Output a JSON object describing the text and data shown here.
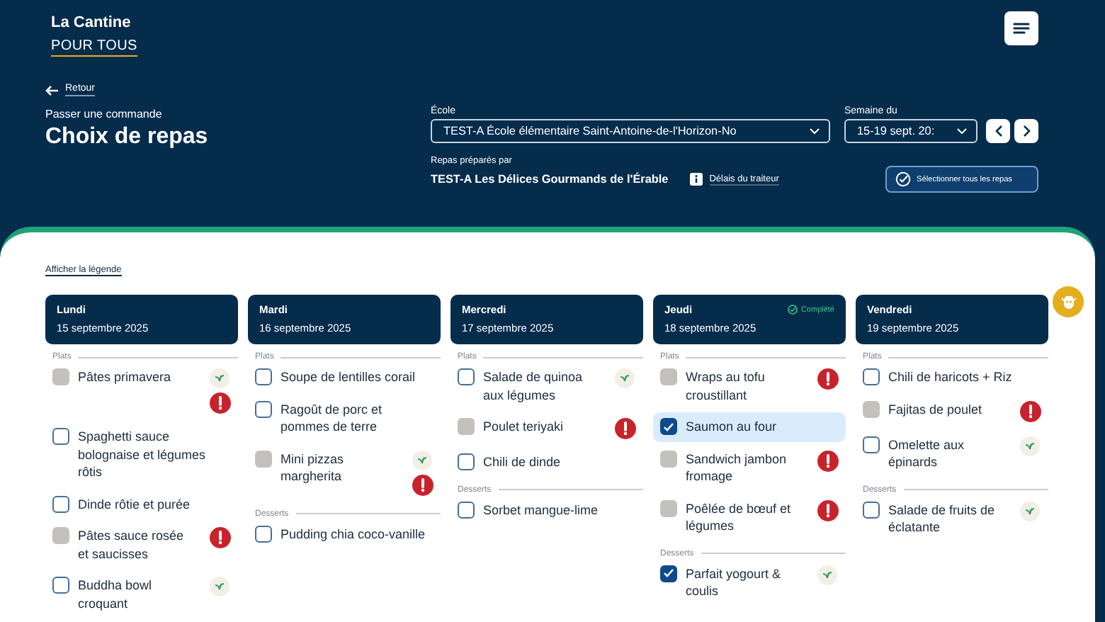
{
  "logo": {
    "line_1": "La Cantine",
    "line_2": "POUR TOUS"
  },
  "back_link": "Retour",
  "page": {
    "subtitle": "Passer une commande",
    "title": "Choix de repas"
  },
  "school": {
    "label": "École",
    "value": "TEST-A École élémentaire Saint-Antoine-de-l'Horizon-No"
  },
  "week": {
    "label": "Semaine du",
    "value": "15-19 sept. 20:"
  },
  "caterer": {
    "label": "Repas préparés par",
    "name": "TEST-A Les Délices Gourmands de l'Érable",
    "link": "Délais du traiteur"
  },
  "select_all_button": "Sélectionner tous les repas",
  "legend_link": "Afficher la légende",
  "days": [
    {
      "name": "Lundi",
      "date": "15 septembre 2025",
      "groups": [
        {
          "label": "Plats",
          "items": [
            {
              "name": "Pâtes primavera",
              "checked": false,
              "disabled": true,
              "highlighted": false,
              "vegetarian": true,
              "alert": true
            },
            {
              "name": "Spaghetti sauce bolognaise et légumes rôtis",
              "checked": false,
              "disabled": false,
              "highlighted": false,
              "vegetarian": false,
              "alert": false
            },
            {
              "name": "Dinde rôtie et purée",
              "checked": false,
              "disabled": false,
              "highlighted": false,
              "vegetarian": false,
              "alert": false
            },
            {
              "name": "Pâtes sauce rosée et saucisses",
              "checked": false,
              "disabled": true,
              "highlighted": false,
              "vegetarian": false,
              "alert": true
            },
            {
              "name": "Buddha bowl croquant",
              "checked": false,
              "disabled": false,
              "highlighted": false,
              "vegetarian": true,
              "alert": false
            }
          ]
        }
      ]
    },
    {
      "name": "Mardi",
      "date": "16 septembre 2025",
      "groups": [
        {
          "label": "Plats",
          "items": [
            {
              "name": "Soupe de lentilles corail",
              "checked": false,
              "disabled": false,
              "highlighted": false,
              "vegetarian": false,
              "alert": false
            },
            {
              "name": "Ragoût de porc et pommes de terre",
              "checked": false,
              "disabled": false,
              "highlighted": false,
              "vegetarian": false,
              "alert": false
            },
            {
              "name": "Mini pizzas margherita",
              "checked": false,
              "disabled": true,
              "highlighted": false,
              "vegetarian": true,
              "alert": true
            }
          ]
        },
        {
          "label": "Desserts",
          "items": [
            {
              "name": "Pudding chia coco-vanille",
              "checked": false,
              "disabled": false,
              "highlighted": false,
              "vegetarian": false,
              "alert": false
            }
          ]
        }
      ]
    },
    {
      "name": "Mercredi",
      "date": "17 septembre 2025",
      "groups": [
        {
          "label": "Plats",
          "items": [
            {
              "name": "Salade de quinoa aux légumes",
              "checked": false,
              "disabled": false,
              "highlighted": false,
              "vegetarian": true,
              "alert": false
            },
            {
              "name": "Poulet teriyaki",
              "checked": false,
              "disabled": true,
              "highlighted": false,
              "vegetarian": false,
              "alert": true
            },
            {
              "name": "Chili de dinde",
              "checked": false,
              "disabled": false,
              "highlighted": false,
              "vegetarian": false,
              "alert": false
            }
          ]
        },
        {
          "label": "Desserts",
          "items": [
            {
              "name": "Sorbet mangue-lime",
              "checked": false,
              "disabled": false,
              "highlighted": false,
              "vegetarian": false,
              "alert": false
            }
          ]
        }
      ]
    },
    {
      "name": "Jeudi",
      "date": "18 septembre 2025",
      "status": "Complété",
      "groups": [
        {
          "label": "Plats",
          "items": [
            {
              "name": "Wraps au tofu croustillant",
              "checked": false,
              "disabled": true,
              "highlighted": false,
              "vegetarian": false,
              "alert": true
            },
            {
              "name": "Saumon au four",
              "checked": true,
              "disabled": false,
              "highlighted": true,
              "vegetarian": false,
              "alert": false
            },
            {
              "name": "Sandwich jambon fromage",
              "checked": false,
              "disabled": true,
              "highlighted": false,
              "vegetarian": false,
              "alert": true
            },
            {
              "name": "Poêlée de bœuf et légumes",
              "checked": false,
              "disabled": true,
              "highlighted": false,
              "vegetarian": false,
              "alert": true
            }
          ]
        },
        {
          "label": "Desserts",
          "items": [
            {
              "name": "Parfait yogourt & coulis",
              "checked": true,
              "disabled": false,
              "highlighted": false,
              "vegetarian": true,
              "alert": false
            }
          ]
        }
      ]
    },
    {
      "name": "Vendredi",
      "date": "19 septembre 2025",
      "groups": [
        {
          "label": "Plats",
          "items": [
            {
              "name": "Chili de haricots + Riz",
              "checked": false,
              "disabled": false,
              "highlighted": false,
              "vegetarian": false,
              "alert": false
            },
            {
              "name": "Fajitas de poulet",
              "checked": false,
              "disabled": true,
              "highlighted": false,
              "vegetarian": false,
              "alert": true
            },
            {
              "name": "Omelette aux épinards",
              "checked": false,
              "disabled": false,
              "highlighted": false,
              "vegetarian": true,
              "alert": false
            }
          ]
        },
        {
          "label": "Desserts",
          "items": [
            {
              "name": "Salade de fruits de éclatante",
              "checked": false,
              "disabled": false,
              "highlighted": false,
              "vegetarian": true,
              "alert": false
            }
          ]
        }
      ]
    }
  ]
}
